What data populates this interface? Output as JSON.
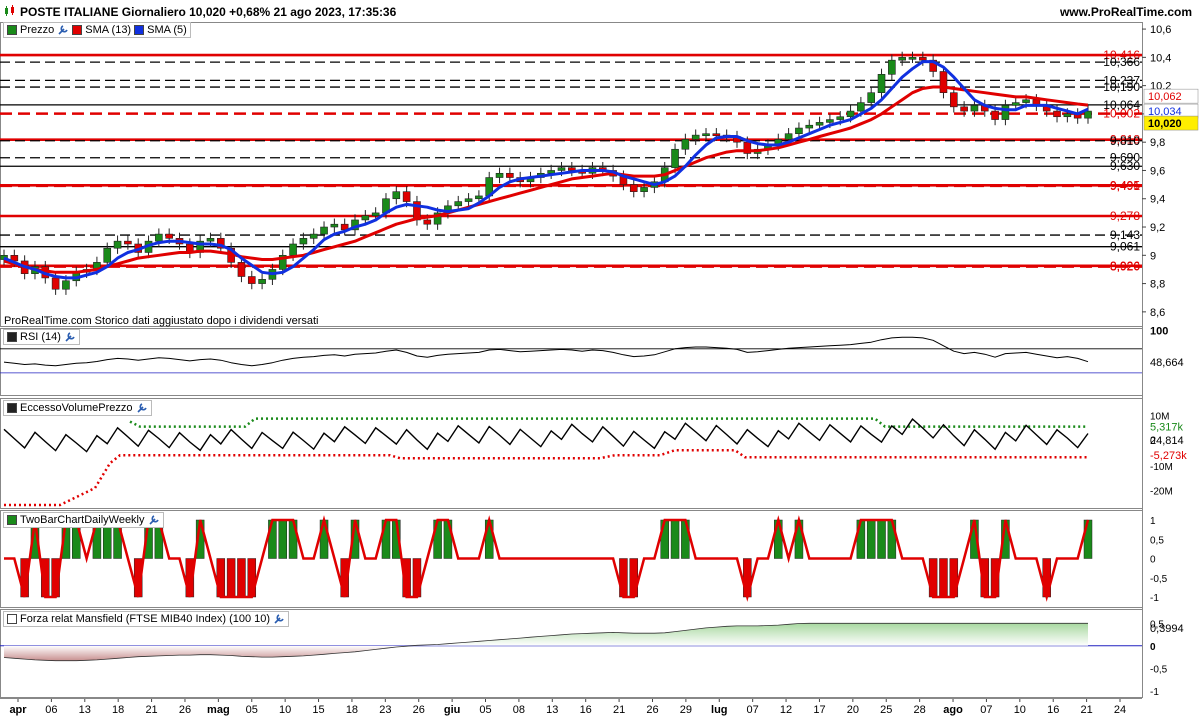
{
  "header": {
    "title": "POSTE ITALIANE Giornaliero 10,020 +0,68% 21 ago 2023, 17:35:36",
    "site": "www.ProRealTime.com"
  },
  "price_pane": {
    "legend": [
      {
        "label": "Prezzo",
        "color": "#1a8a1a"
      },
      {
        "label": "SMA (13)",
        "color": "#e00000"
      },
      {
        "label": "SMA (5)",
        "color": "#1030e0"
      }
    ],
    "note": "ProRealTime.com Storico dati aggiustato dopo i dividendi versati",
    "axis_ticks": [
      "10,6",
      "10,4",
      "10,2",
      "10",
      "9,8",
      "9,6",
      "9,4",
      "9,2",
      "9",
      "8,8",
      "8,6"
    ],
    "last_price_label": "10,020",
    "sma13_label": "10,062",
    "sma5_label": "10,034",
    "levels": [
      {
        "value": 10.416,
        "label": "10,416",
        "style": "solid-red"
      },
      {
        "value": 10.366,
        "label": "10,366",
        "style": "dash-black"
      },
      {
        "value": 10.237,
        "label": "10,237",
        "style": "dash-black"
      },
      {
        "value": 10.19,
        "label": "10,190",
        "style": "dash-black"
      },
      {
        "value": 10.064,
        "label": "10,064",
        "style": "solid-black"
      },
      {
        "value": 10.002,
        "label": "10,002",
        "style": "dash-red"
      },
      {
        "value": 9.818,
        "label": "9,818",
        "style": "solid-red"
      },
      {
        "value": 9.81,
        "label": "9,810",
        "style": "dash-black"
      },
      {
        "value": 9.69,
        "label": "9,690",
        "style": "dash-black"
      },
      {
        "value": 9.63,
        "label": "9,630",
        "style": "solid-black"
      },
      {
        "value": 9.495,
        "label": "9,495",
        "style": "solid-red"
      },
      {
        "value": 9.491,
        "label": "9,491",
        "style": "dash-red"
      },
      {
        "value": 9.278,
        "label": "9,278",
        "style": "solid-red"
      },
      {
        "value": 9.143,
        "label": "9,143",
        "style": "dash-black"
      },
      {
        "value": 9.061,
        "label": "9,061",
        "style": "solid-black"
      },
      {
        "value": 8.926,
        "label": "8,926",
        "style": "solid-red"
      },
      {
        "value": 8.92,
        "label": "8,920",
        "style": "dash-red"
      }
    ]
  },
  "rsi_pane": {
    "label": "RSI (14)",
    "ticks": [
      "100"
    ],
    "value_label": "48,664"
  },
  "volume_pane": {
    "label": "EccessoVolumePrezzo",
    "ticks": [
      "10M",
      "0",
      "-10M",
      "-20M"
    ],
    "upper_label": "5,317k",
    "value_label": "24,814",
    "lower_label": "-5,273k"
  },
  "twobar_pane": {
    "label": "TwoBarChartDailyWeekly",
    "ticks": [
      "1",
      "0,5",
      "0",
      "-0,5",
      "-1"
    ]
  },
  "mansfield_pane": {
    "label": "Forza relat Mansfield (FTSE MIB40 Index) (100 10)",
    "ticks": [
      "0,5",
      "0",
      "-0,5",
      "-1"
    ],
    "value_label": "0,3994"
  },
  "x_axis": {
    "labels": [
      {
        "text": "apr",
        "bold": true
      },
      {
        "text": "06",
        "bold": false
      },
      {
        "text": "13",
        "bold": false
      },
      {
        "text": "18",
        "bold": false
      },
      {
        "text": "21",
        "bold": false
      },
      {
        "text": "26",
        "bold": false
      },
      {
        "text": "mag",
        "bold": true
      },
      {
        "text": "05",
        "bold": false
      },
      {
        "text": "10",
        "bold": false
      },
      {
        "text": "15",
        "bold": false
      },
      {
        "text": "18",
        "bold": false
      },
      {
        "text": "23",
        "bold": false
      },
      {
        "text": "26",
        "bold": false
      },
      {
        "text": "giu",
        "bold": true
      },
      {
        "text": "05",
        "bold": false
      },
      {
        "text": "08",
        "bold": false
      },
      {
        "text": "13",
        "bold": false
      },
      {
        "text": "16",
        "bold": false
      },
      {
        "text": "21",
        "bold": false
      },
      {
        "text": "26",
        "bold": false
      },
      {
        "text": "29",
        "bold": false
      },
      {
        "text": "lug",
        "bold": true
      },
      {
        "text": "07",
        "bold": false
      },
      {
        "text": "12",
        "bold": false
      },
      {
        "text": "17",
        "bold": false
      },
      {
        "text": "20",
        "bold": false
      },
      {
        "text": "25",
        "bold": false
      },
      {
        "text": "28",
        "bold": false
      },
      {
        "text": "ago",
        "bold": true
      },
      {
        "text": "07",
        "bold": false
      },
      {
        "text": "10",
        "bold": false
      },
      {
        "text": "16",
        "bold": false
      },
      {
        "text": "21",
        "bold": false
      },
      {
        "text": "24",
        "bold": false
      }
    ]
  },
  "chart_data": {
    "type": "line",
    "title": "POSTE ITALIANE Giornaliero 10,020 +0,68% 21 ago 2023, 17:35:36",
    "close": [
      9.0,
      8.96,
      8.87,
      8.92,
      8.84,
      8.76,
      8.82,
      8.88,
      8.9,
      8.95,
      9.05,
      9.1,
      9.08,
      9.02,
      9.1,
      9.15,
      9.12,
      9.08,
      9.02,
      9.1,
      9.12,
      9.05,
      8.95,
      8.85,
      8.8,
      8.83,
      8.9,
      9.0,
      9.08,
      9.12,
      9.15,
      9.2,
      9.22,
      9.18,
      9.25,
      9.28,
      9.3,
      9.4,
      9.45,
      9.38,
      9.25,
      9.22,
      9.3,
      9.35,
      9.38,
      9.4,
      9.42,
      9.55,
      9.58,
      9.55,
      9.52,
      9.55,
      9.58,
      9.6,
      9.62,
      9.6,
      9.58,
      9.62,
      9.6,
      9.56,
      9.5,
      9.45,
      9.48,
      9.52,
      9.62,
      9.75,
      9.82,
      9.85,
      9.86,
      9.85,
      9.84,
      9.8,
      9.72,
      9.75,
      9.78,
      9.82,
      9.86,
      9.9,
      9.92,
      9.94,
      9.96,
      9.98,
      10.02,
      10.08,
      10.15,
      10.28,
      10.38,
      10.4,
      10.4,
      10.38,
      10.3,
      10.15,
      10.05,
      10.02,
      10.06,
      10.02,
      9.96,
      10.06,
      10.08,
      10.1,
      10.06,
      10.02,
      9.98,
      10.0,
      9.97,
      10.02
    ],
    "sma13": [
      8.96,
      8.94,
      8.92,
      8.9,
      8.89,
      8.88,
      8.88,
      8.88,
      8.89,
      8.9,
      8.92,
      8.94,
      8.96,
      8.98,
      8.99,
      9.0,
      9.01,
      9.02,
      9.02,
      9.03,
      9.03,
      9.02,
      9.01,
      8.99,
      8.98,
      8.97,
      8.97,
      8.98,
      8.99,
      9.0,
      9.02,
      9.04,
      9.06,
      9.08,
      9.1,
      9.13,
      9.16,
      9.19,
      9.22,
      9.24,
      9.26,
      9.27,
      9.28,
      9.3,
      9.32,
      9.34,
      9.36,
      9.38,
      9.4,
      9.42,
      9.44,
      9.46,
      9.48,
      9.5,
      9.52,
      9.54,
      9.55,
      9.56,
      9.57,
      9.58,
      9.57,
      9.56,
      9.56,
      9.56,
      9.57,
      9.6,
      9.63,
      9.66,
      9.69,
      9.71,
      9.73,
      9.74,
      9.74,
      9.74,
      9.75,
      9.76,
      9.78,
      9.8,
      9.82,
      9.84,
      9.86,
      9.88,
      9.9,
      9.93,
      9.96,
      10.0,
      10.05,
      10.1,
      10.15,
      10.18,
      10.19,
      10.19,
      10.18,
      10.17,
      10.16,
      10.15,
      10.14,
      10.13,
      10.12,
      10.12,
      10.11,
      10.1,
      10.09,
      10.08,
      10.07,
      10.062
    ],
    "sma5": [
      8.98,
      8.95,
      8.92,
      8.9,
      8.87,
      8.85,
      8.84,
      8.84,
      8.86,
      8.88,
      8.92,
      8.98,
      9.02,
      9.04,
      9.07,
      9.09,
      9.1,
      9.1,
      9.09,
      9.08,
      9.08,
      9.07,
      9.04,
      8.98,
      8.93,
      8.88,
      8.87,
      8.88,
      8.92,
      8.98,
      9.04,
      9.11,
      9.15,
      9.17,
      9.2,
      9.22,
      9.25,
      9.3,
      9.34,
      9.36,
      9.35,
      9.34,
      9.32,
      9.31,
      9.32,
      9.33,
      9.37,
      9.42,
      9.48,
      9.52,
      9.54,
      9.55,
      9.56,
      9.57,
      9.58,
      9.59,
      9.6,
      9.6,
      9.6,
      9.59,
      9.56,
      9.54,
      9.52,
      9.5,
      9.52,
      9.56,
      9.63,
      9.71,
      9.78,
      9.83,
      9.84,
      9.84,
      9.81,
      9.79,
      9.78,
      9.78,
      9.8,
      9.83,
      9.86,
      9.89,
      9.92,
      9.94,
      9.96,
      10.0,
      10.04,
      10.1,
      10.18,
      10.26,
      10.32,
      10.37,
      10.37,
      10.33,
      10.26,
      10.18,
      10.1,
      10.06,
      10.04,
      10.03,
      10.03,
      10.06,
      10.06,
      10.06,
      10.04,
      10.02,
      10.0,
      10.034
    ],
    "rsi": [
      48,
      46,
      44,
      45,
      43,
      42,
      44,
      46,
      47,
      49,
      52,
      54,
      53,
      51,
      53,
      55,
      54,
      52,
      50,
      52,
      53,
      51,
      47,
      44,
      42,
      44,
      47,
      51,
      54,
      56,
      57,
      59,
      60,
      58,
      61,
      62,
      63,
      66,
      68,
      64,
      58,
      56,
      59,
      61,
      62,
      63,
      64,
      68,
      69,
      67,
      65,
      66,
      67,
      68,
      69,
      68,
      66,
      68,
      67,
      64,
      60,
      57,
      58,
      60,
      65,
      70,
      72,
      73,
      73,
      72,
      71,
      69,
      64,
      65,
      67,
      69,
      71,
      72,
      73,
      74,
      75,
      76,
      77,
      79,
      81,
      85,
      88,
      89,
      89,
      88,
      84,
      75,
      66,
      62,
      64,
      61,
      56,
      62,
      63,
      64,
      61,
      58,
      55,
      57,
      54,
      48.664
    ],
    "ylim": [
      8.5,
      10.65
    ]
  }
}
